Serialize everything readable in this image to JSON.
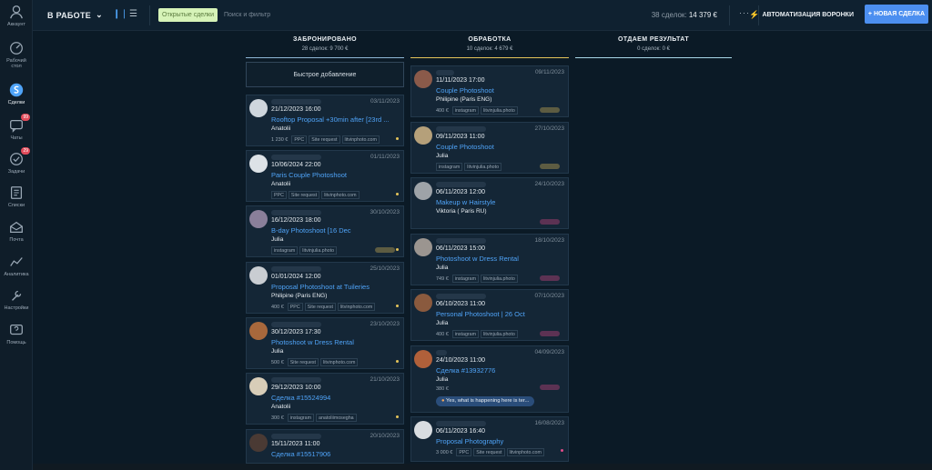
{
  "sidebar": {
    "items": [
      {
        "label": "Аккаунт",
        "icon": "avatar-icon",
        "badge": ""
      },
      {
        "label": "Рабочий стол",
        "icon": "dashboard-icon",
        "badge": ""
      },
      {
        "label": "Сделки",
        "icon": "deals-icon",
        "badge": ""
      },
      {
        "label": "Чаты",
        "icon": "chat-icon",
        "badge": "99"
      },
      {
        "label": "Задачи",
        "icon": "tasks-icon",
        "badge": "29"
      },
      {
        "label": "Списки",
        "icon": "lists-icon",
        "badge": ""
      },
      {
        "label": "Почта",
        "icon": "mail-icon",
        "badge": ""
      },
      {
        "label": "Аналитика",
        "icon": "analytics-icon",
        "badge": ""
      },
      {
        "label": "Настройки",
        "icon": "settings-icon",
        "badge": ""
      },
      {
        "label": "Помощь",
        "icon": "help-icon",
        "badge": ""
      }
    ]
  },
  "header": {
    "pipeline": "В РАБОТЕ",
    "filter_chip": "Открытые сделки",
    "search_placeholder": "Поиск и фильтр",
    "deals_count": "38 сделок:",
    "deals_sum": "14 379 €",
    "more": "···",
    "automation_label": "АВТОМАТИЗАЦИЯ ВОРОНКИ",
    "new_deal_label": "+ НОВАЯ СДЕЛКА"
  },
  "colors": {
    "accent": "#4c8ff0",
    "link": "#4fa3f7",
    "col1_line": "#8fb7d6",
    "col2_line": "#e4c45a",
    "col3_line": "#a8d8e8"
  },
  "columns": [
    {
      "title": "ЗАБРОНИРОВАНО",
      "summary": "28 сделок: 9 700 €",
      "quick_add": "Быстрое добавление"
    },
    {
      "title": "ОБРАБОТКА",
      "summary": "10 сделок: 4 679 €"
    },
    {
      "title": "ОТДАЕМ РЕЗУЛЬТАТ",
      "summary": "0 сделок: 0 €"
    }
  ],
  "col1_cards": [
    {
      "date": "03/11/2023",
      "dt": "21/12/2023 16:00",
      "title": "Rooftop Proposal +30min after [23rd ...",
      "resp": "Anatolii",
      "price": "1 230 €",
      "tags": [
        "PPC",
        "Site request",
        "litvinphoto.com"
      ],
      "dot": "#e4c45a"
    },
    {
      "date": "01/11/2023",
      "dt": "10/06/2024 22:00",
      "title": "Paris Couple Photoshoot",
      "resp": "Anatolii",
      "price": "",
      "tags": [
        "PPC",
        "Site request",
        "litvinphoto.com"
      ],
      "dot": "#e4c45a"
    },
    {
      "date": "30/10/2023",
      "dt": "16/12/2023 18:00",
      "title": "B-day Photoshoot [16 Dec",
      "resp": "Julia",
      "price": "",
      "tags": [
        "instagram",
        "litvinjulia.photo"
      ],
      "dot": "#e4c45a"
    },
    {
      "date": "25/10/2023",
      "dt": "01/01/2024 12:00",
      "title": "Proposal Photoshoot at Tuileries",
      "resp": "Philipine (Paris ENG)",
      "price": "400 €",
      "tags": [
        "PPC",
        "Site request",
        "litvinphoto.com"
      ],
      "dot": "#e4c45a"
    },
    {
      "date": "23/10/2023",
      "dt": "30/12/2023 17:30",
      "title": "Photoshoot w Dress Rental",
      "resp": "Julia",
      "price": "500 €",
      "tags": [
        "Site request",
        "litvinphoto.com"
      ],
      "dot": "#e4c45a"
    },
    {
      "date": "21/10/2023",
      "dt": "29/12/2023 10:00",
      "title": "Сделка #15524994",
      "resp": "Anatolii",
      "price": "300 €",
      "tags": [
        "instagram",
        "anatoliimosegha"
      ],
      "dot": "#e4c45a"
    },
    {
      "date": "20/10/2023",
      "dt": "15/11/2023 11:00",
      "title": "Сделка #15517906",
      "resp": "",
      "price": "",
      "tags": [],
      "dot": ""
    }
  ],
  "col2_cards": [
    {
      "date": "09/11/2023",
      "dt": "11/11/2023 17:00",
      "title": "Couple Photoshoot",
      "resp": "Philipine (Paris ENG)",
      "price": "400 €",
      "tags": [
        "instagram",
        "litvinjulia.photo"
      ],
      "dot": ""
    },
    {
      "date": "27/10/2023",
      "dt": "09/11/2023 11:00",
      "title": "Couple Photoshoot",
      "resp": "Julia",
      "price": "",
      "tags": [
        "instagram",
        "litvinjulia.photo"
      ],
      "dot": ""
    },
    {
      "date": "24/10/2023",
      "dt": "06/11/2023 12:00",
      "title": "Makeup w Hairstyle",
      "resp": "Viktoria ( Paris RU)",
      "price": "",
      "tags": [],
      "dot": "#e24b8a"
    },
    {
      "date": "18/10/2023",
      "dt": "06/11/2023 15:00",
      "title": "Photoshoot w Dress Rental",
      "resp": "Julia",
      "price": "749 €",
      "tags": [
        "instagram",
        "litvinjulia.photo"
      ],
      "dot": ""
    },
    {
      "date": "07/10/2023",
      "dt": "06/10/2023 11:00",
      "title": "Personal Photoshoot | 26 Oct",
      "resp": "Julia",
      "price": "400 €",
      "tags": [
        "instagram",
        "litvinjulia.photo"
      ],
      "dot": ""
    },
    {
      "date": "04/09/2023",
      "dt": "24/10/2023 11:00",
      "title": "Сделка #13932776",
      "resp": "Julia",
      "price": "380 €",
      "tags": [],
      "dot": "",
      "reply": "Yes, what is happening here is ter..."
    },
    {
      "date": "16/08/2023",
      "dt": "06/11/2023 16:40",
      "title": "Proposal Photography",
      "resp": "",
      "price": "3 000 €",
      "tags": [
        "PPC",
        "Site request",
        "litvinphoto.com"
      ],
      "dot": "#e24b8a"
    }
  ]
}
